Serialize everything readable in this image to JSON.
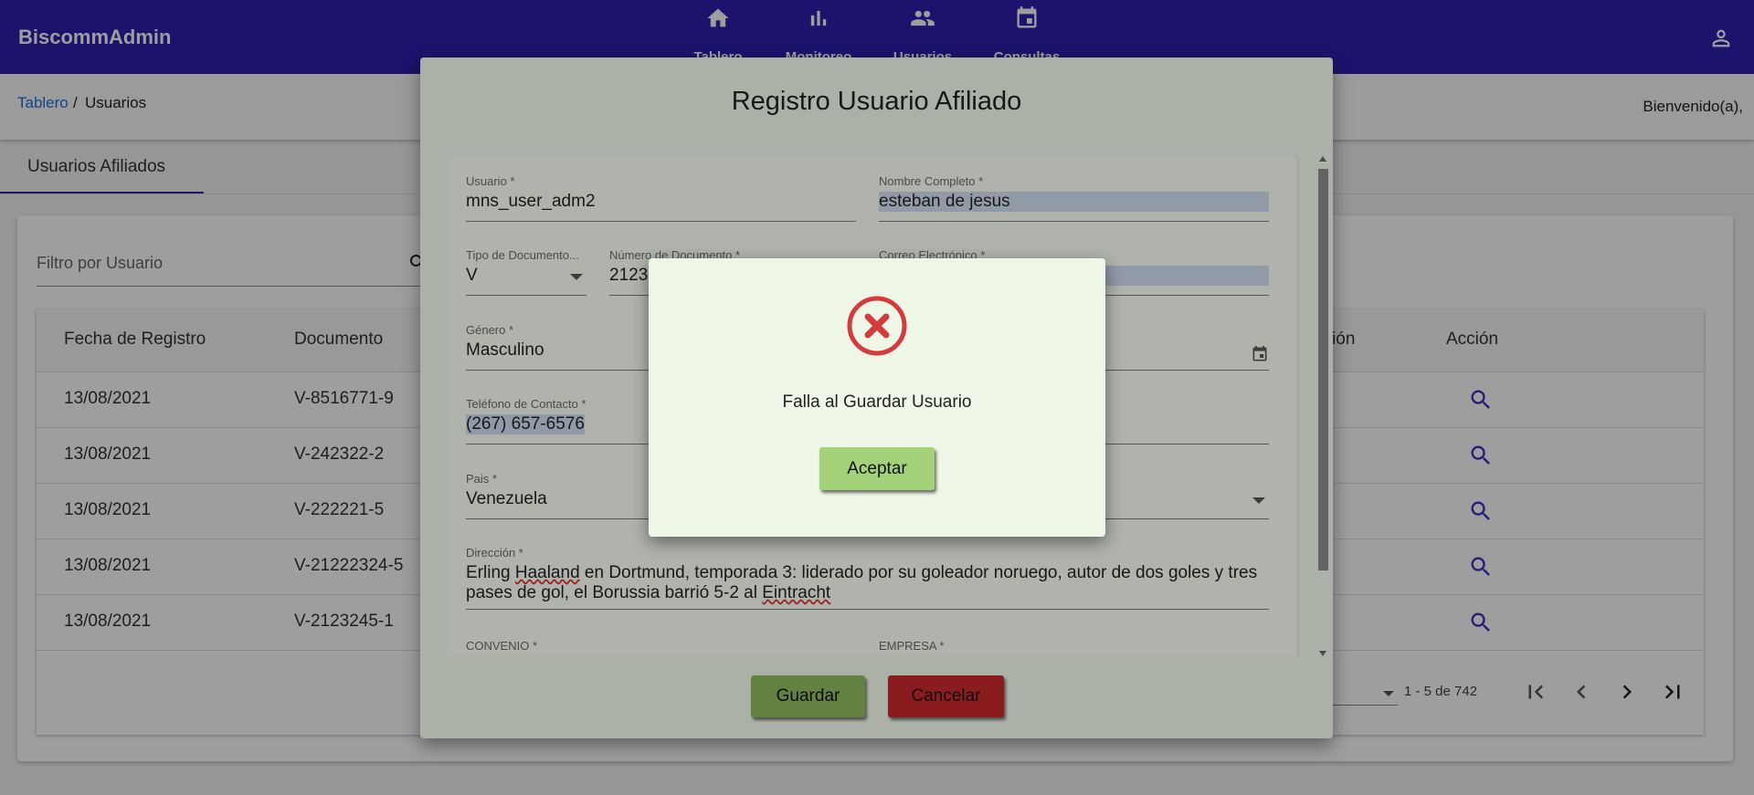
{
  "app": {
    "brand": "BiscommAdmin"
  },
  "nav": [
    {
      "label": "Tablero",
      "icon": "home-icon"
    },
    {
      "label": "Monitoreo",
      "icon": "bar-chart-icon"
    },
    {
      "label": "Usuarios",
      "icon": "people-icon"
    },
    {
      "label": "Consultas",
      "icon": "calendar-icon"
    }
  ],
  "breadcrumb": {
    "link": "Tablero",
    "separator": "/",
    "current": "Usuarios"
  },
  "welcome": "Bienvenido(a),",
  "tab": {
    "label": "Usuarios Afiliados"
  },
  "filter": {
    "placeholder": "Filtro por Usuario"
  },
  "table": {
    "headers": [
      "Fecha de Registro",
      "Documento",
      "ación",
      "Acción"
    ],
    "rows": [
      {
        "date": "13/08/2021",
        "doc": "V-8516771-9"
      },
      {
        "date": "13/08/2021",
        "doc": "V-242322-2"
      },
      {
        "date": "13/08/2021",
        "doc": "V-222221-5"
      },
      {
        "date": "13/08/2021",
        "doc": "V-21222324-5"
      },
      {
        "date": "13/08/2021",
        "doc": "V-2123245-1"
      }
    ],
    "range": "1 - 5 de 742"
  },
  "dialog": {
    "title": "Registro Usuario Afiliado",
    "fields": {
      "usuario": {
        "label": "Usuario *",
        "value": "mns_user_adm2"
      },
      "nombre": {
        "label": "Nombre Completo *",
        "value": "esteban de jesus"
      },
      "tipo_doc": {
        "label": "Tipo de Documento...",
        "value": "V"
      },
      "num_doc": {
        "label": "Número de Documento *",
        "value": "2123"
      },
      "correo": {
        "label": "Correo Electrónico *",
        "value": ""
      },
      "genero": {
        "label": "Género *",
        "value": "Masculino"
      },
      "telefono": {
        "label": "Teléfono de Contacto *",
        "value": "(267) 657-6576"
      },
      "pais": {
        "label": "Pais *",
        "value": "Venezuela"
      },
      "direccion": {
        "label": "Dirección *",
        "value_pre": "Erling ",
        "value_spell1": "Haaland",
        "value_mid": " en Dortmund, temporada 3: liderado por su goleador noruego, autor de dos goles y tres pases de gol, el Borussia barrió 5-2 al ",
        "value_spell2": "Eintracht"
      },
      "convenio": {
        "label": "CONVENIO *"
      },
      "empresa": {
        "label": "EMPRESA *"
      }
    },
    "save_label": "Guardar",
    "cancel_label": "Cancelar"
  },
  "alert": {
    "message": "Falla al Guardar Usuario",
    "accept_label": "Aceptar",
    "icon": "error-x-icon",
    "icon_color": "#d63b3b"
  },
  "colors": {
    "toolbar": "#2e1fb0",
    "link": "#1e6fd9",
    "save": "#8ab55a",
    "cancel": "#c0282c",
    "accept": "#a3d279"
  }
}
